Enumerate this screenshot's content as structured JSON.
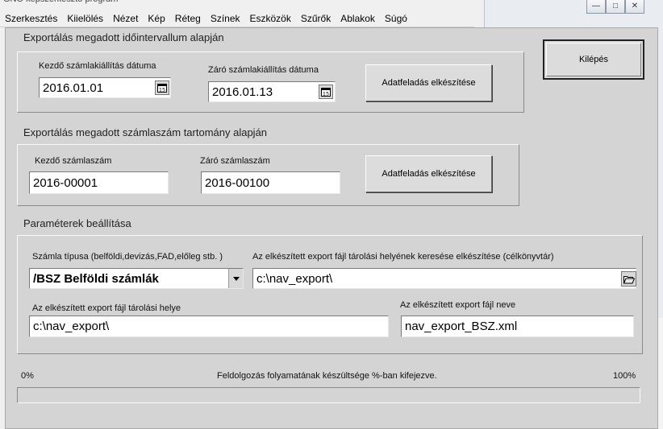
{
  "background_app": {
    "title": "GNO képszerkesztő program",
    "menu": [
      "Szerkesztés",
      "Kiielölés",
      "Nézet",
      "Kép",
      "Réteg",
      "Színek",
      "Eszközök",
      "Szűrők",
      "Ablakok",
      "Súgó"
    ]
  },
  "window_controls": {
    "minimize": "—",
    "maximize": "□",
    "close": "✕"
  },
  "date_section": {
    "title": "Exportálás megadott időintervallum alapján",
    "start_label": "Kezdő számlakiállítás dátuma",
    "start_value": "2016.01.01",
    "end_label": "Záró számlakiállítás dátuma",
    "end_value": "2016.01.13",
    "submit_label": "Adatfeladás elkészítése"
  },
  "number_section": {
    "title": "Exportálás megadott számlaszám tartomány alapján",
    "start_label": "Kezdő számlaszám",
    "start_value": "2016-00001",
    "end_label": "Záró számlaszám",
    "end_value": "2016-00100",
    "submit_label": "Adatfeladás elkészítése"
  },
  "params_section": {
    "title": "Paraméterek beállítása",
    "invoice_type_label": "Számla típusa  (belföldi,devizás,FAD,előleg stb. )",
    "invoice_type_value": "/BSZ Belföldi számlák",
    "search_label": "Az elkészített export fájl tárolási helyének keresése elkészítése (célkönyvtár)",
    "search_value": "c:\\nav_export\\",
    "location_label": "Az elkészített export fájl tárolási helye",
    "location_value": "c:\\nav_export\\",
    "filename_label": "Az elkészített export fájl neve",
    "filename_value": "nav_export_BSZ.xml"
  },
  "progress": {
    "min_label": "0%",
    "caption": "Feldolgozás folyamatának készültsége %-ban kifejezve.",
    "max_label": "100%",
    "value": 0
  },
  "exit_label": "Kilépés",
  "colors": {
    "dialog_bg": "#d4d4d4",
    "progress_fill": "#3a6ea5"
  }
}
